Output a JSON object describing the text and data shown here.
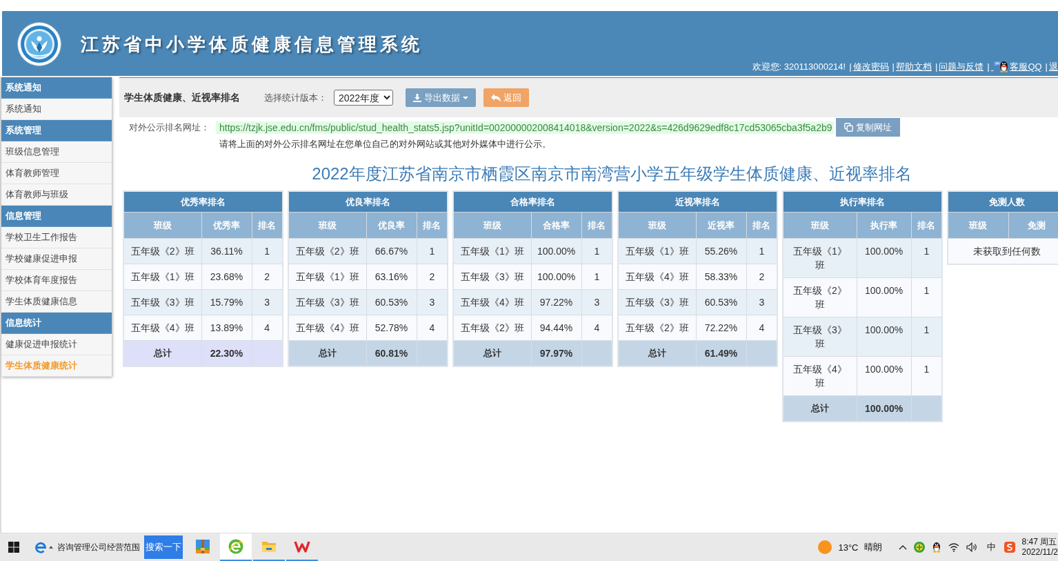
{
  "header": {
    "title": "江苏省中小学体质健康信息管理系统",
    "welcome": "欢迎您: 320113000214!",
    "links": [
      {
        "sep": "|",
        "label": "修改密码",
        "kind": "plain"
      },
      {
        "sep": "|",
        "label": "帮助文档",
        "kind": "plain"
      },
      {
        "sep": "|",
        "label": "问题与反馈",
        "kind": "plain"
      },
      {
        "sep": "|",
        "label": "客服QQ",
        "kind": "with-icon"
      },
      {
        "sep": "|",
        "label": "退",
        "kind": "plain"
      }
    ]
  },
  "sidebar": {
    "sections": [
      {
        "title": "系统通知",
        "items": [
          {
            "label": "系统通知",
            "selected": false
          }
        ]
      },
      {
        "title": "系统管理",
        "items": [
          {
            "label": "班级信息管理",
            "selected": false
          },
          {
            "label": "体育教师管理",
            "selected": false
          },
          {
            "label": "体育教师与班级",
            "selected": false
          }
        ]
      },
      {
        "title": "信息管理",
        "items": [
          {
            "label": "学校卫生工作报告",
            "selected": false
          },
          {
            "label": "学校健康促进申报",
            "selected": false
          },
          {
            "label": "学校体育年度报告",
            "selected": false
          },
          {
            "label": "学生体质健康信息",
            "selected": false
          }
        ]
      },
      {
        "title": "信息统计",
        "items": [
          {
            "label": "健康促进申报统计",
            "selected": false
          },
          {
            "label": "学生体质健康统计",
            "selected": true
          }
        ]
      }
    ]
  },
  "toolbar": {
    "title": "学生体质健康、近视率排名",
    "version_label": "选择统计版本：",
    "version": "2022年度",
    "buttons": [
      {
        "label": "导出数据",
        "kind": "export"
      },
      {
        "label": "返回",
        "kind": "back"
      }
    ]
  },
  "public_url": {
    "label": "对外公示排名网址：",
    "url": "https://tzjk.jse.edu.cn/fms/public/stud_health_stats5.jsp?unitId=002000002008414018&version=2022&s=426d9629edf8c17cd53065cba3f5a2b9",
    "copy_button": "复制网址",
    "note": "请将上面的对外公示排名网址在您单位自己的对外网站或其他对外媒体中进行公示。"
  },
  "report_title": "2022年度江苏省南京市栖霞区南京市南湾营小学五年级学生体质健康、近视率排名",
  "tables": [
    {
      "title": "优秀率排名",
      "columns": [
        "班级",
        "优秀率",
        "排名"
      ],
      "rows": [
        [
          "五年级《2》班",
          "36.11%",
          "1"
        ],
        [
          "五年级《1》班",
          "23.68%",
          "2"
        ],
        [
          "五年级《3》班",
          "15.79%",
          "3"
        ],
        [
          "五年级《4》班",
          "13.89%",
          "4"
        ]
      ],
      "total": {
        "label": "总计",
        "value": "22.30%",
        "hovered": true
      }
    },
    {
      "title": "优良率排名",
      "columns": [
        "班级",
        "优良率",
        "排名"
      ],
      "rows": [
        [
          "五年级《2》班",
          "66.67%",
          "1"
        ],
        [
          "五年级《1》班",
          "63.16%",
          "2"
        ],
        [
          "五年级《3》班",
          "60.53%",
          "3"
        ],
        [
          "五年级《4》班",
          "52.78%",
          "4"
        ]
      ],
      "total": {
        "label": "总计",
        "value": "60.81%",
        "hovered": false
      }
    },
    {
      "title": "合格率排名",
      "columns": [
        "班级",
        "合格率",
        "排名"
      ],
      "rows": [
        [
          "五年级《1》班",
          "100.00%",
          "1"
        ],
        [
          "五年级《3》班",
          "100.00%",
          "1"
        ],
        [
          "五年级《4》班",
          "97.22%",
          "3"
        ],
        [
          "五年级《2》班",
          "94.44%",
          "4"
        ]
      ],
      "total": {
        "label": "总计",
        "value": "97.97%",
        "hovered": false
      }
    },
    {
      "title": "近视率排名",
      "columns": [
        "班级",
        "近视率",
        "排名"
      ],
      "rows": [
        [
          "五年级《1》班",
          "55.26%",
          "1"
        ],
        [
          "五年级《4》班",
          "58.33%",
          "2"
        ],
        [
          "五年级《3》班",
          "60.53%",
          "3"
        ],
        [
          "五年级《2》班",
          "72.22%",
          "4"
        ]
      ],
      "total": {
        "label": "总计",
        "value": "61.49%",
        "hovered": false
      }
    },
    {
      "title": "执行率排名",
      "columns": [
        "班级",
        "执行率",
        "排名"
      ],
      "rows": [
        [
          "五年级《1》班",
          "100.00%",
          "1"
        ],
        [
          "五年级《2》班",
          "100.00%",
          "1"
        ],
        [
          "五年级《3》班",
          "100.00%",
          "1"
        ],
        [
          "五年级《4》班",
          "100.00%",
          "1"
        ]
      ],
      "total": {
        "label": "总计",
        "value": "100.00%",
        "hovered": false
      }
    },
    {
      "title": "免测人数",
      "columns": [
        "班级",
        "免测"
      ],
      "empty_message": "未获取到任何数"
    }
  ],
  "taskbar": {
    "search": {
      "value": "咨询管理公司经营范围",
      "button": "搜索一下"
    },
    "apps": [
      {
        "active": false,
        "running": false
      },
      {
        "active": true,
        "running": true
      },
      {
        "active": false,
        "running": true
      },
      {
        "active": false,
        "running": true
      }
    ],
    "weather": {
      "temperature": "13°C",
      "condition": "晴朗"
    },
    "ime": "中",
    "clock": {
      "time": "8:47 周五",
      "date": "2022/11/2"
    }
  }
}
